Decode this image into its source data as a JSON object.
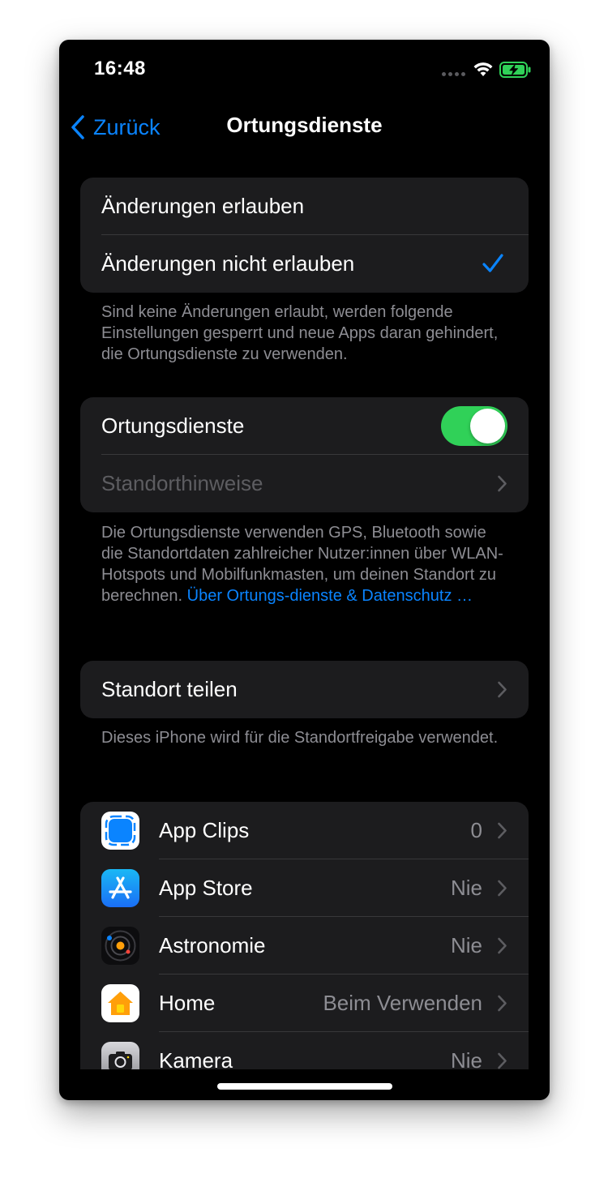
{
  "status_bar": {
    "time": "16:48"
  },
  "nav": {
    "back_label": "Zurück",
    "title": "Ortungsdienste"
  },
  "changes_group": {
    "items": [
      {
        "label": "Änderungen erlauben",
        "selected": false
      },
      {
        "label": "Änderungen nicht erlauben",
        "selected": true
      }
    ],
    "footer": "Sind keine Änderungen erlaubt, werden folgende Einstellungen gesperrt und neue Apps daran gehindert, die Ortungsdienste zu verwenden."
  },
  "location_group": {
    "toggle_label": "Ortungsdienste",
    "toggle_on": true,
    "alerts_label": "Standorthinweise",
    "footer_text": "Die Ortungsdienste verwenden GPS, Bluetooth sowie die Standortdaten zahlreicher Nutzer:innen über WLAN-Hotspots und Mobilfunkmasten, um deinen Standort zu berechnen.",
    "footer_link": "Über Ortungs-dienste & Datenschutz …"
  },
  "share_group": {
    "label": "Standort teilen",
    "footer": "Dieses iPhone wird für die Standortfreigabe verwendet."
  },
  "apps": [
    {
      "name": "App Clips",
      "value": "0",
      "icon": "app-clips-icon"
    },
    {
      "name": "App Store",
      "value": "Nie",
      "icon": "app-store-icon"
    },
    {
      "name": "Astronomie",
      "value": "Nie",
      "icon": "astronomy-icon"
    },
    {
      "name": "Home",
      "value": "Beim Verwenden",
      "icon": "home-app-icon"
    },
    {
      "name": "Kamera",
      "value": "Nie",
      "icon": "camera-icon"
    }
  ],
  "colors": {
    "accent": "#0a84ff",
    "toggle_on": "#30d158",
    "cell_bg": "#1c1c1e",
    "background": "#000000"
  }
}
